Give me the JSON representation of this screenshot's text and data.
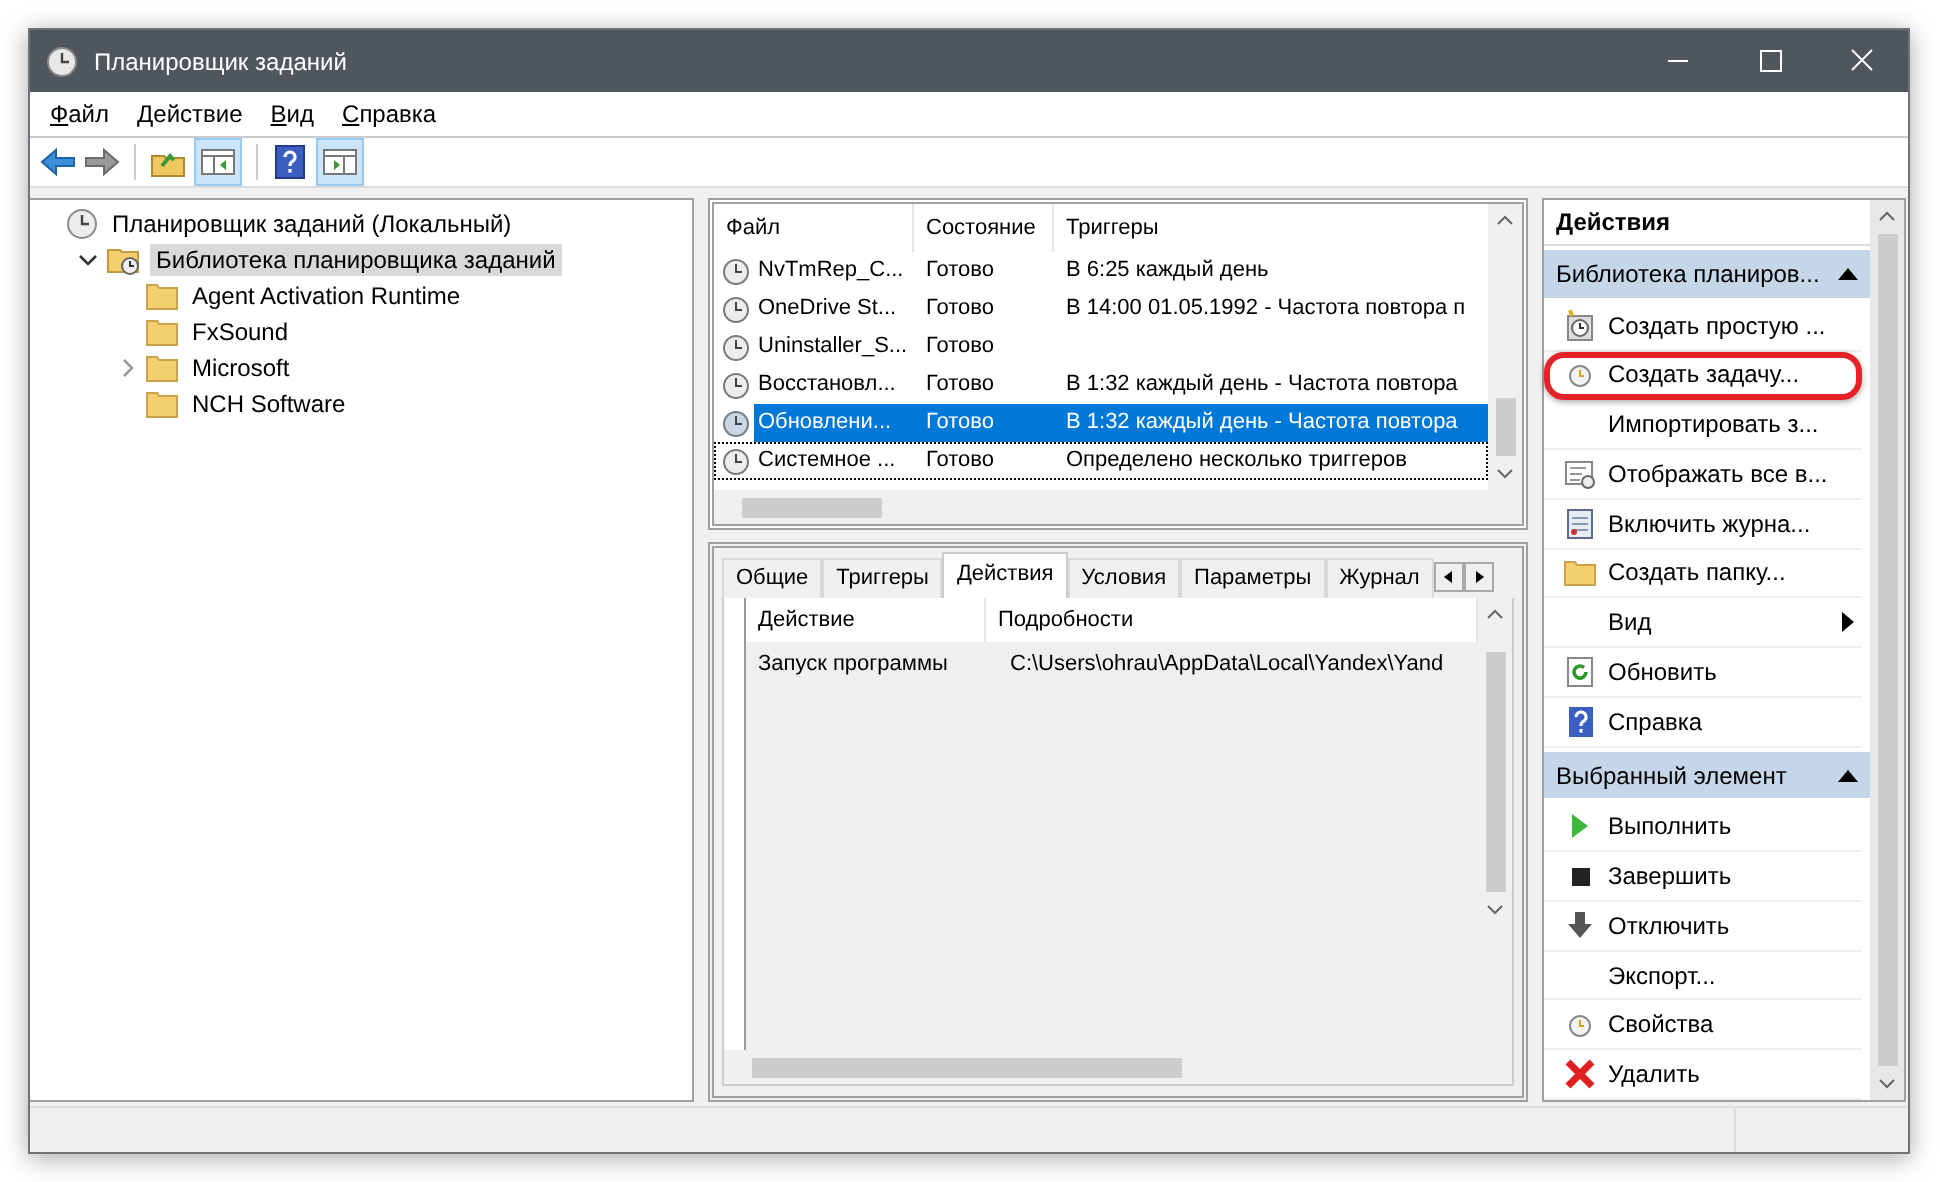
{
  "window": {
    "title": "Планировщик заданий"
  },
  "menu": [
    {
      "label": "Файл"
    },
    {
      "label": "Действие"
    },
    {
      "label": "Вид"
    },
    {
      "label": "Справка"
    }
  ],
  "tree": [
    {
      "label": "Планировщик заданий (Локальный)",
      "selected": false,
      "children": [
        {
          "label": "Библиотека планировщика заданий",
          "selected": true,
          "expanded": true,
          "children": [
            {
              "label": "Agent Activation Runtime",
              "selected": false
            },
            {
              "label": "FxSound",
              "selected": false
            },
            {
              "label": "Microsoft",
              "selected": false,
              "expanded": false
            },
            {
              "label": "NCH Software",
              "selected": false
            }
          ]
        }
      ]
    }
  ],
  "tasks": {
    "columns": [
      "Файл",
      "Состояние",
      "Триггеры"
    ],
    "rows": [
      {
        "name": "NvTmRep_C...",
        "status": "Готово",
        "triggers": "В 6:25 каждый день",
        "selected": false,
        "focused": false
      },
      {
        "name": "OneDrive St...",
        "status": "Готово",
        "triggers": "В 14:00 01.05.1992 - Частота повтора п",
        "selected": false,
        "focused": false
      },
      {
        "name": "Uninstaller_S...",
        "status": "Готово",
        "selected": false,
        "focused": false
      },
      {
        "name": "Восстановл...",
        "status": "Готово",
        "triggers": "В 1:32 каждый день - Частота повтора",
        "selected": false,
        "focused": false
      },
      {
        "name": "Обновлени...",
        "status": "Готово",
        "triggers": "В 1:32 каждый день - Частота повтора",
        "selected": true,
        "focused": false
      },
      {
        "name": "Системное ...",
        "status": "Готово",
        "triggers": "Определено несколько триггеров",
        "selected": false,
        "focused": true
      }
    ]
  },
  "tabs": [
    {
      "label": "Общие",
      "selected": false
    },
    {
      "label": "Триггеры",
      "selected": false
    },
    {
      "label": "Действия",
      "selected": true
    },
    {
      "label": "Условия",
      "selected": false
    },
    {
      "label": "Параметры",
      "selected": false
    },
    {
      "label": "Журнал",
      "selected": false
    }
  ],
  "task_actions": {
    "columns": [
      "Действие",
      "Подробности"
    ],
    "rows": [
      {
        "action": "Запуск программы",
        "details": "C:\\Users\\ohrau\\AppData\\Local\\Yandex\\Yand"
      }
    ]
  },
  "actions_pane": {
    "title": "Действия",
    "sections": [
      {
        "title": "Библиотека планиров...",
        "expanded": true,
        "items": [
          {
            "label": "Создать простую ...",
            "kind": "item",
            "highlighted": false
          },
          {
            "label": "Создать задачу...",
            "kind": "item",
            "highlighted": true
          },
          {
            "label": "Импортировать з...",
            "kind": "item",
            "highlighted": false
          },
          {
            "label": "Отображать все в...",
            "kind": "item",
            "highlighted": false
          },
          {
            "label": "Включить журна...",
            "kind": "item",
            "highlighted": false
          },
          {
            "label": "Создать папку...",
            "kind": "item",
            "highlighted": false
          },
          {
            "label": "Вид",
            "kind": "submenu",
            "highlighted": false
          },
          {
            "label": "Обновить",
            "kind": "item",
            "highlighted": false
          },
          {
            "label": "Справка",
            "kind": "item",
            "highlighted": false
          }
        ]
      },
      {
        "title": "Выбранный элемент",
        "expanded": true,
        "items": [
          {
            "label": "Выполнить",
            "kind": "item",
            "highlighted": false
          },
          {
            "label": "Завершить",
            "kind": "item",
            "highlighted": false
          },
          {
            "label": "Отключить",
            "kind": "item",
            "highlighted": false
          },
          {
            "label": "Экспорт...",
            "kind": "item",
            "highlighted": false
          },
          {
            "label": "Свойства",
            "kind": "item",
            "highlighted": false
          },
          {
            "label": "Удалить",
            "kind": "item",
            "highlighted": false
          }
        ]
      }
    ]
  }
}
